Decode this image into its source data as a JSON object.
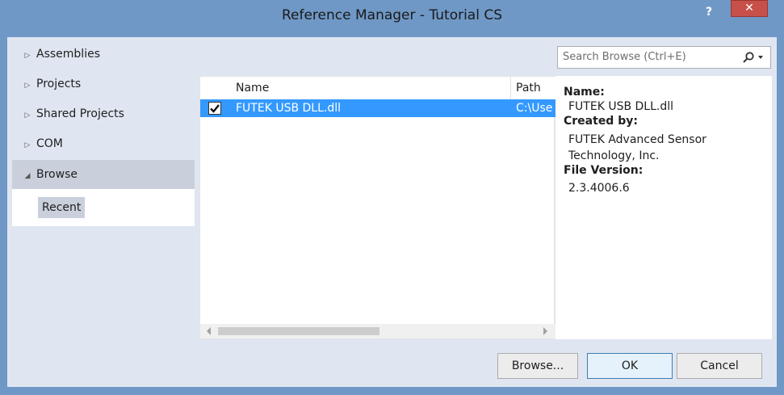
{
  "window": {
    "title": "Reference Manager - Tutorial CS",
    "help_label": "?",
    "close_label": "✕"
  },
  "sidebar": {
    "items": [
      {
        "label": "Assemblies",
        "expanded": false
      },
      {
        "label": "Projects",
        "expanded": false
      },
      {
        "label": "Shared Projects",
        "expanded": false
      },
      {
        "label": "COM",
        "expanded": false
      },
      {
        "label": "Browse",
        "expanded": true
      }
    ],
    "subitems": [
      {
        "label": "Recent"
      }
    ]
  },
  "search": {
    "placeholder": "Search Browse (Ctrl+E)",
    "icon": "search-icon"
  },
  "file_list": {
    "columns": [
      "Name",
      "Path"
    ],
    "rows": [
      {
        "checked": true,
        "name": "FUTEK USB DLL.dll",
        "path": "C:\\Use",
        "selected": true
      }
    ]
  },
  "details": {
    "name_label": "Name:",
    "name_value": "FUTEK USB DLL.dll",
    "created_label": "Created by:",
    "created_value_line1": "FUTEK Advanced Sensor",
    "created_value_line2": "Technology, Inc.",
    "version_label": "File Version:",
    "version_value": "2.3.4006.6"
  },
  "buttons": {
    "browse": "Browse...",
    "ok": "OK",
    "cancel": "Cancel"
  },
  "colors": {
    "title_bar": "#6f98c6",
    "close_button": "#c7504a",
    "selection": "#3399ff",
    "client_background": "#dfe6f1"
  }
}
